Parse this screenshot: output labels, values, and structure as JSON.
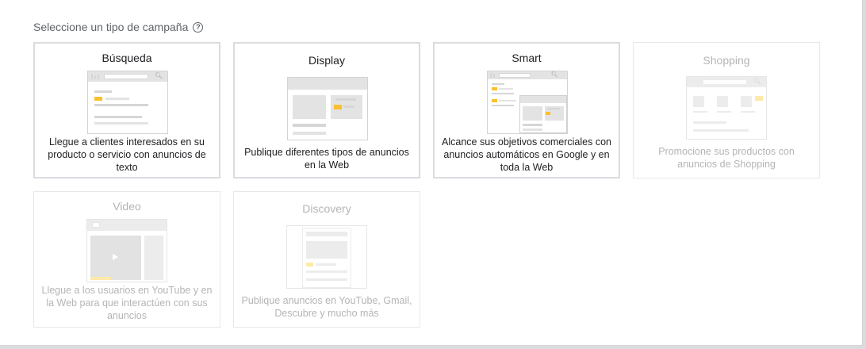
{
  "page": {
    "heading": "Seleccione un tipo de campaña",
    "help_icon": "question-circle-icon",
    "help_glyph": "?"
  },
  "colors": {
    "accent_yellow": "#fbc02d",
    "border": "#dadce0",
    "text_primary": "#202124",
    "text_disabled": "#b5b5b5"
  },
  "cards": [
    {
      "title": "Búsqueda",
      "description": "Llegue a clientes interesados en su producto o servicio con anuncios de texto",
      "enabled": true,
      "icon": "search-illustration-icon"
    },
    {
      "title": "Display",
      "description": "Publique diferentes tipos de anuncios en la Web",
      "enabled": true,
      "icon": "display-illustration-icon"
    },
    {
      "title": "Smart",
      "description": "Alcance sus objetivos comerciales con anuncios automáticos en Google y en toda la Web",
      "enabled": true,
      "icon": "smart-illustration-icon"
    },
    {
      "title": "Shopping",
      "description": "Promocione sus productos con anuncios de Shopping",
      "enabled": false,
      "icon": "shopping-illustration-icon"
    },
    {
      "title": "Video",
      "description": "Llegue a los usuarios en YouTube y en la Web para que interactúen con sus anuncios",
      "enabled": false,
      "icon": "video-illustration-icon"
    },
    {
      "title": "Discovery",
      "description": "Publique anuncios en YouTube, Gmail, Descubre y mucho más",
      "enabled": false,
      "icon": "discovery-illustration-icon"
    }
  ]
}
